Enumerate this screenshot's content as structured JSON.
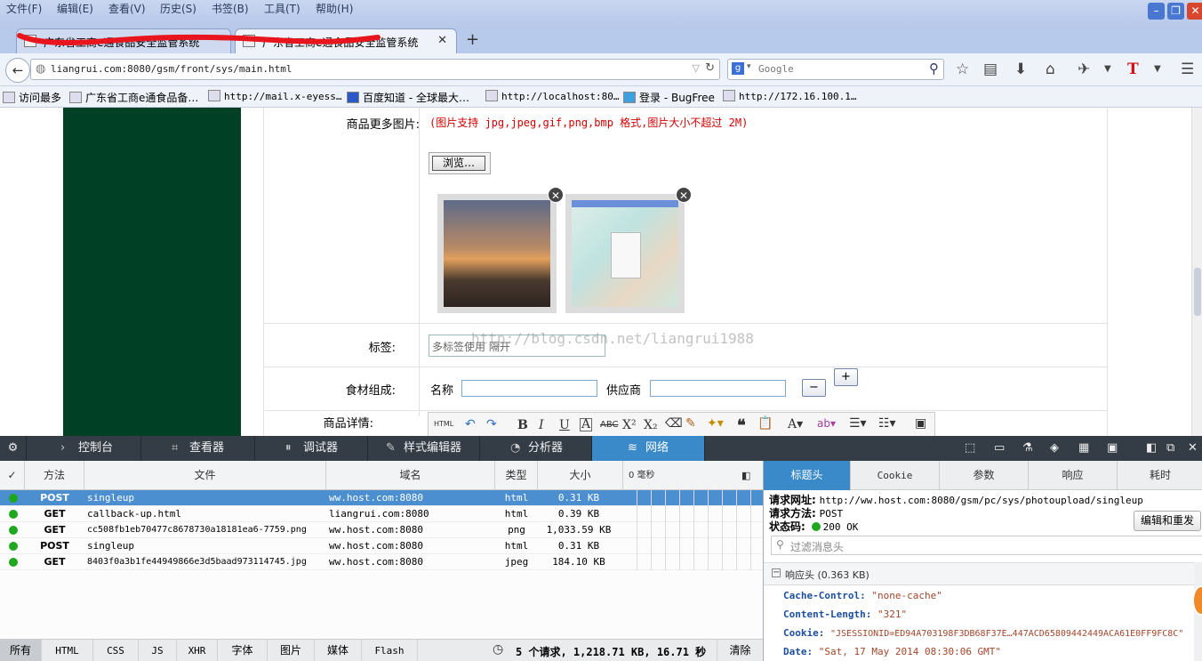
{
  "menu": [
    "文件(F)",
    "编辑(E)",
    "查看(V)",
    "历史(S)",
    "书签(B)",
    "工具(T)",
    "帮助(H)"
  ],
  "tabs": [
    {
      "label": "广东省工商e通食品安全监管系统"
    },
    {
      "label": "广东省工商e通食品安全监管系统"
    }
  ],
  "nav": {
    "url": "liangrui.com:8080/gsm/front/sys/main.html",
    "search_placeholder": "Google"
  },
  "bookmarks": [
    "访问最多",
    "广东省工商e通食品备…",
    "http://mail.x-eyess…",
    "百度知道 - 全球最大…",
    "http://localhost:80…",
    "登录 - BugFree",
    "http://172.16.100.1…"
  ],
  "form": {
    "more_images_label": "商品更多图片:",
    "image_hint": "(图片支持 jpg,jpeg,gif,png,bmp 格式,图片大小不超过 2M)",
    "browse_button": "浏览…",
    "tags_label": "标签:",
    "tags_placeholder": "多标签使用 隔开",
    "watermark": "http://blog.csdn.net/liangrui1988",
    "ingredients_label": "食材组成:",
    "name_label": "名称",
    "supplier_label": "供应商",
    "minus": "−",
    "plus": "+",
    "details_label": "商品详情:",
    "rte_html": "HTML"
  },
  "devtools": {
    "tabs": [
      "控制台",
      "查看器",
      "调试器",
      "样式编辑器",
      "分析器",
      "网络"
    ],
    "active_tab": "网络",
    "columns": [
      "✓",
      "方法",
      "文件",
      "域名",
      "类型",
      "大小",
      "0 毫秒"
    ],
    "requests": [
      {
        "method": "POST",
        "file": "singleup",
        "domain": "ww.host.com:8080",
        "type": "html",
        "size": "0.31 KB",
        "selected": true
      },
      {
        "method": "GET",
        "file": "callback-up.html",
        "domain": "liangrui.com:8080",
        "type": "html",
        "size": "0.39 KB",
        "selected": false
      },
      {
        "method": "GET",
        "file": "cc508fb1eb70477c8678730a18181ea6-7759.png",
        "domain": "ww.host.com:8080",
        "type": "png",
        "size": "1,033.59 KB",
        "selected": false
      },
      {
        "method": "POST",
        "file": "singleup",
        "domain": "ww.host.com:8080",
        "type": "html",
        "size": "0.31 KB",
        "selected": false
      },
      {
        "method": "GET",
        "file": "8403f0a3b1fe44949866e3d5baad973114745.jpg",
        "domain": "ww.host.com:8080",
        "type": "jpeg",
        "size": "184.10 KB",
        "selected": false
      }
    ],
    "filters": [
      "所有",
      "HTML",
      "CSS",
      "JS",
      "XHR",
      "字体",
      "图片",
      "媒体",
      "Flash"
    ],
    "summary": "5 个请求, 1,218.71 KB, 16.71 秒",
    "clear": "清除",
    "side_tabs": [
      "标题头",
      "Cookie",
      "参数",
      "响应",
      "耗时"
    ],
    "request_url_label": "请求网址:",
    "request_url": "http://ww.host.com:8080/gsm/pc/sys/photoupload/singleup",
    "request_method_label": "请求方法:",
    "request_method": "POST",
    "status_label": "状态码:",
    "status": "200 OK",
    "edit_resend": "编辑和重发",
    "filter_placeholder": "过滤消息头",
    "response_headers": "响应头 (0.363 KB)",
    "headers": [
      {
        "k": "Cache-Control:",
        "v": "\"none-cache\""
      },
      {
        "k": "Content-Length:",
        "v": "\"321\""
      },
      {
        "k": "Cookie:",
        "v": "\"JSESSIONID=ED94A703198F3DB68F37E…447ACD65809442449ACA61E0FF9FC8C\""
      },
      {
        "k": "Date:",
        "v": "\"Sat, 17 May 2014 08:30:06 GMT\""
      }
    ]
  },
  "colors": {
    "devtools_bg": "#343c45",
    "accent": "#3a89c9",
    "status_ok": "#1fa71f",
    "hint_red": "#d40000",
    "sidebar_green": "#004024"
  }
}
